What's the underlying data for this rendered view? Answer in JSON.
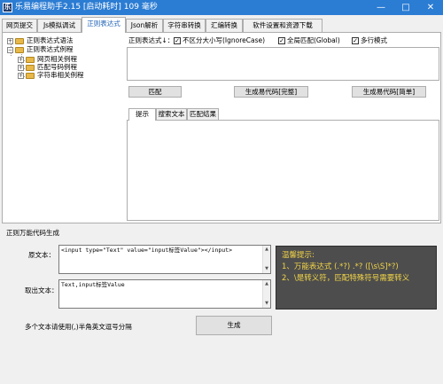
{
  "window": {
    "title": "乐易编程助手2.15 [启动耗时] 109 毫秒",
    "app_icon_text": "乐",
    "controls": {
      "minimize": "—",
      "maximize": "□",
      "close": "✕"
    }
  },
  "main_tabs": [
    "网页提交",
    "Js模拟调试",
    "正则表达式",
    "Json解析",
    "字符串转换",
    "汇编转换",
    "软件设置和资源下载"
  ],
  "active_tab": "正则表达式",
  "tree": {
    "nodes": [
      {
        "label": "正则表达式语法"
      },
      {
        "label": "正则表达式例程"
      },
      {
        "label": "网页相关例程"
      },
      {
        "label": "匹配号码例程"
      },
      {
        "label": "字符串相关例程"
      }
    ]
  },
  "regex": {
    "label": "正则表达式↓：",
    "options": [
      {
        "label": "不区分大小写(IgnoreCase)",
        "checked": true
      },
      {
        "label": "全局匹配(Global)",
        "checked": true
      },
      {
        "label": "多行模式",
        "checked": true
      }
    ],
    "check_glyph": "✓",
    "value": ""
  },
  "buttons": {
    "match": "匹配",
    "gen_full": "生成易代码[完整]",
    "gen_simple": "生成易代码[简单]",
    "generate": "生成"
  },
  "result_tabs": [
    "提示",
    "搜索文本",
    "匹配结果"
  ],
  "generator": {
    "section_title": "正则万能代码生成",
    "source_label": "原文本：",
    "source_value": "<input type=\"Text\" value=\"input标签Value\"></input>",
    "fetch_label": "取出文本：",
    "fetch_value": "Text,input标签Value",
    "hint": "多个文本请使用(,)半角英文逗号分隔"
  },
  "tips": {
    "title": "温馨提示:",
    "line1": "1、万能表达式 (.*?) .*? ([\\s\\S]*?)",
    "line2": "2、\\是转义符，匹配特殊符号需要转义"
  },
  "scroll": {
    "up": "▲",
    "down": "▼"
  },
  "tree_glyphs": {
    "plus": "+",
    "minus": "−"
  },
  "colors": {
    "titlebar": "#2b7cd3",
    "tip_bg": "#4d4d4d",
    "tip_text": "#f2d548"
  }
}
